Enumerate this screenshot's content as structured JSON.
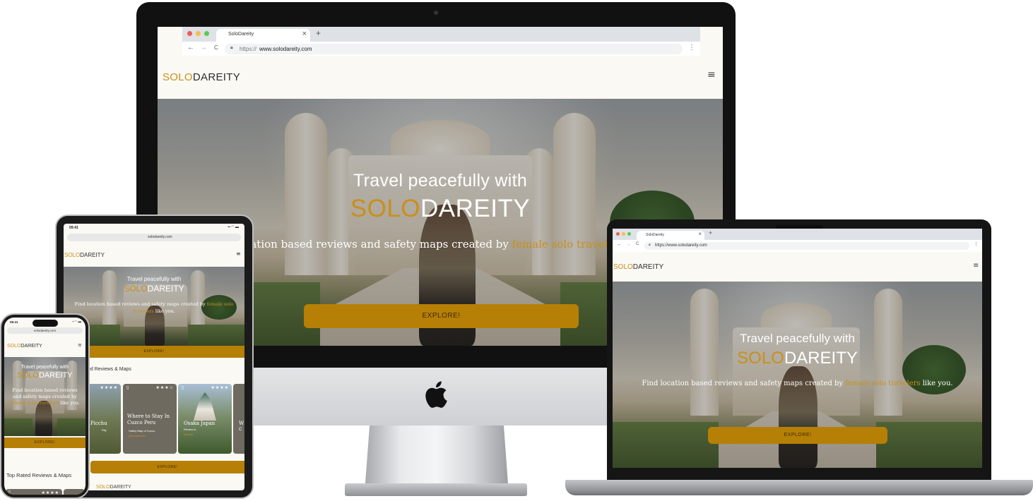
{
  "site": {
    "logo_a": "SOLO",
    "logo_b": "DAREITY",
    "hero_line1": "Travel peacefully with",
    "hero_brand_a": "SOLO",
    "hero_brand_b": "DAREITY",
    "tagline_pre": "Find location based reviews and safety maps created by",
    "tagline_link": "female solo travelers",
    "tagline_post": "like you.",
    "explore": "EXPLORE!",
    "menu_icon": "hamburger-icon",
    "section_title": "Top Rated Reviews & Maps",
    "section_title_partial": "ed Reviews & Maps",
    "brand_color": "#b67f06",
    "accent_color": "#c8901a"
  },
  "browser": {
    "tab_title": "SoloDareity",
    "tab_close": "×",
    "new_tab": "+",
    "url_prefix": "https://",
    "url_host": "www.solodareity.com",
    "url_full": "https://www.solodareity.com",
    "nav_back": "←",
    "nav_forward": "→",
    "nav_reload": "C",
    "menu_dots": "⋮"
  },
  "tablet": {
    "status_time": "09:41",
    "status_icons": "▪▪ ◠ ▬",
    "url": "solodareity.com",
    "cards": [
      {
        "title": "Picchu",
        "sub": "Pity",
        "stars": "★★★★"
      },
      {
        "title": "Where to Stay In Cuzco Peru",
        "sub": "Safety Map of Cuzco",
        "tag": "@dreamselia",
        "stars": "★★★☆"
      },
      {
        "title": "Osaka Japan",
        "sub": "Review in",
        "tag": "@mary",
        "stars": "★★★★"
      },
      {
        "title": "W",
        "sub": "C",
        "stars": ""
      }
    ],
    "footer_logo_a": "SOLO",
    "footer_logo_b": "DAREITY"
  },
  "phone": {
    "status_time": "09:41",
    "status_icons": "▪ ◠ ▬",
    "url": "solodareity.com",
    "tagline_l1": "Find location based reviews",
    "tagline_l2": "and safety maps created by",
    "tagline_l3_link": "female solo travelers",
    "tagline_l3_post": "like you.",
    "card_stars": "★★★★"
  },
  "icons": {
    "apple": "apple-logo-icon",
    "lock": "lock-icon",
    "map": "map-icon"
  }
}
